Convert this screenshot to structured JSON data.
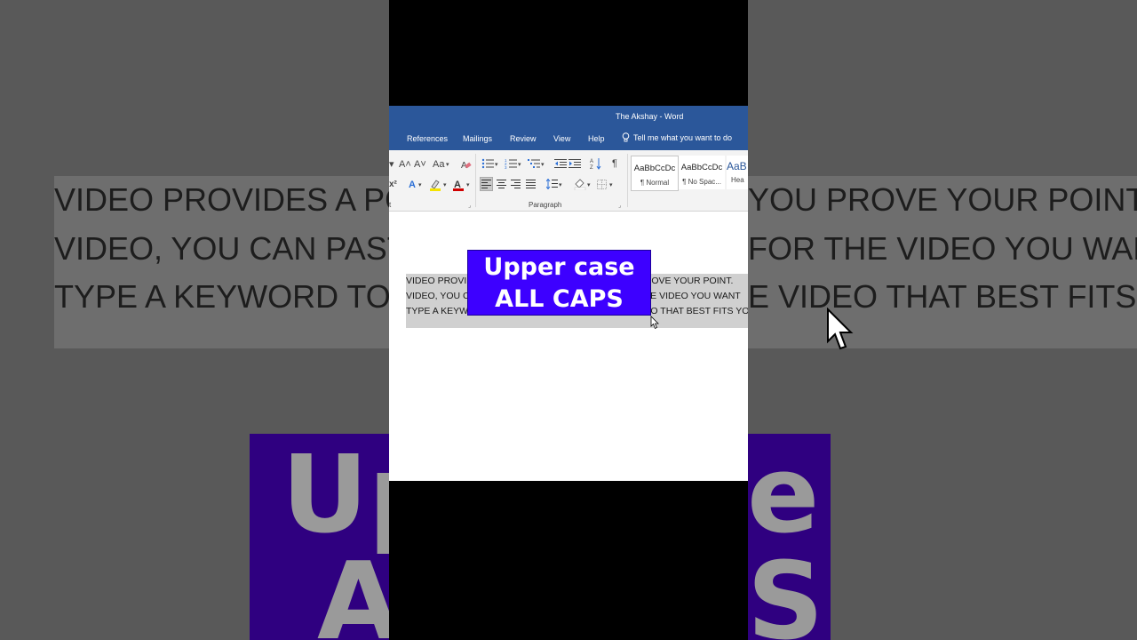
{
  "window": {
    "title": "The Akshay  -  Word"
  },
  "tabs": [
    "References",
    "Mailings",
    "Review",
    "View",
    "Help"
  ],
  "tell_me": "Tell me what you want to do",
  "ribbon": {
    "font_group_label_fragment": "t",
    "paragraph_label": "Paragraph",
    "styles": [
      {
        "preview": "AaBbCcDc",
        "label": "¶ Normal"
      },
      {
        "preview": "AaBbCcDc",
        "label": "¶ No Spac..."
      },
      {
        "preview": "AaB",
        "label": "Hea"
      }
    ],
    "font_size_up": "A˄",
    "font_size_down": "A˅",
    "change_case": "Aa",
    "pilcrow": "¶",
    "superscript": "x²"
  },
  "document": {
    "lines": [
      "VIDEO PROVIDES A POWERFUL WAY TO HELP YOU PROVE YOUR POINT.",
      "VIDEO, YOU CAN PASTE IN THE EMBED CODE FOR THE VIDEO YOU WANT",
      "TYPE A KEYWORD TO SEARCH ONLINE FOR THE VIDEO THAT BEST FITS YO"
    ]
  },
  "badge": {
    "line1": "Upper case",
    "line2": "ALL CAPS"
  },
  "background": {
    "lines": [
      "VIDEO PROVIDES A PO",
      "VIDEO, YOU CAN PAST",
      "TYPE A KEYWORD TO S"
    ],
    "lines_right": [
      "YOU PROVE YOUR POINT. V",
      "FOR THE VIDEO YOU WANT",
      "E VIDEO THAT BEST FITS YO"
    ],
    "big_left": "Up",
    "big_right": "e",
    "big_left2": "A",
    "big_right2": "S"
  },
  "colors": {
    "word_blue": "#2b579a",
    "badge_purple": "#3d00ff",
    "selection": "#d0d0d0"
  }
}
